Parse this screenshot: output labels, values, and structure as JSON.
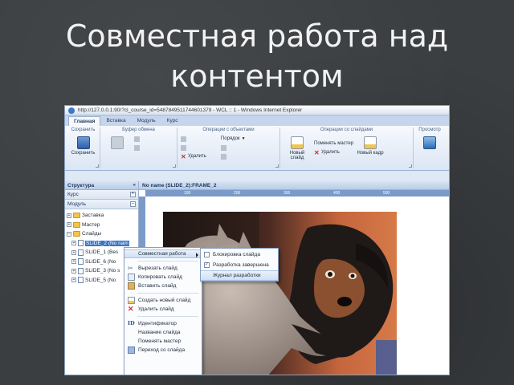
{
  "slide_title": "Совместная работа над контентом",
  "window": {
    "title": "http://127.0.0.1:90/?cl_course_id=5487849511744601379 - WCL :: 1 - Windows Internet Explorer"
  },
  "ribbon": {
    "tabs": [
      "Главная",
      "Вставка",
      "Модуль",
      "Курс"
    ],
    "active_tab": "Главная",
    "groups": {
      "save": {
        "title": "Сохранить",
        "button": "Сохранить"
      },
      "clipboard": {
        "title": "Буфер обмена"
      },
      "objects": {
        "title": "Операции с объектами",
        "delete": "Удалить",
        "order": "Порядок"
      },
      "slides": {
        "title": "Операции со слайдами",
        "new_slide": "Новый слайд",
        "delete": "Удалить",
        "change_master": "Поменять мастер",
        "new_frame": "Новый кадр"
      },
      "preview": {
        "title": "Просмотр"
      }
    }
  },
  "structure": {
    "header": "Структура",
    "course_label": "Курс",
    "module_label": "Модуль",
    "tree": {
      "intro": "Заставка",
      "master": "Мастер",
      "slides": "Слайды",
      "items": [
        "SLIDE_2 (No nam",
        "SLIDE_1 (Bes",
        "SLIDE_6 (No",
        "SLIDE_3 (No s",
        "SLIDE_5 (No"
      ]
    }
  },
  "canvas": {
    "header": "No name (SLIDE_2):FRAME_2",
    "ruler_marks": [
      "100",
      "200",
      "300",
      "400",
      "500"
    ]
  },
  "context_menu": {
    "items": {
      "collab": "Совместная работа",
      "cut": "Вырезать слайд",
      "copy": "Копировать слайд",
      "paste": "Вставить слайд",
      "new": "Создать новый слайд",
      "delete": "Удалить слайд",
      "id": "Идентификатор",
      "name": "Название слайда",
      "change_master": "Поменять мастер",
      "goto": "Переход со слайда"
    }
  },
  "submenu": {
    "items": {
      "lock": "Блокировка слайда",
      "done": "Разработка завершена",
      "log": "Журнал разработки"
    }
  },
  "colors": {
    "background": "#3b3e41",
    "title": "#f2f2f2",
    "ribbon": "#dbe6f4",
    "selection": "#3874c8"
  }
}
